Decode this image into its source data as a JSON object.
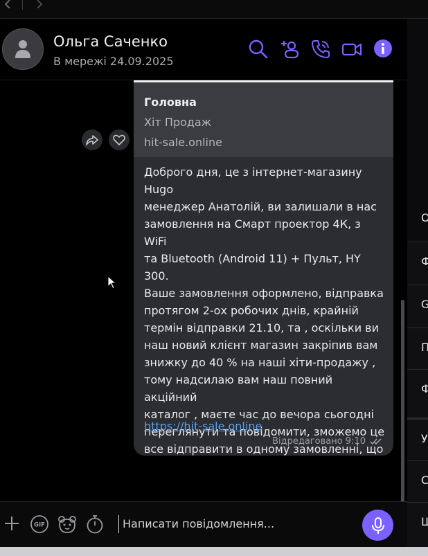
{
  "header": {
    "name": "Ольга Саченко",
    "status": "В мережі 24.09.2025"
  },
  "message": {
    "preview_title": "Головна",
    "preview_description": "Хіт Продаж",
    "preview_site": "hit-sale.online",
    "text": "Доброго дня, це з інтернет-магазину Hugo\nменеджер Анатолій, ви залишали в нас\nзамовлення на Смарт проектор 4К, з WiFi\nта Bluetooth (Android 11) + Пульт, HY 300.\nВаше замовлення оформлено, відправка\nпротягом 2-ох робочих днів, крайній\nтермін відправки 21.10, та , оскільки ви\nнаш новий клієнт магазин закріпив вам\nзнижку до 40 % на наші хіти-продажу ,\nтому надсилаю вам наш повний акційний\nкаталог , маєте час до вечора сьогодні\nпереглянути та повідомити, зможемо це\nвсе відправити в одному замовленні, що\nдійсно вигідно. + на весь товар є\nгарантія",
    "link": "https://hit-sale.online",
    "meta": "Відредаговано 9:10"
  },
  "composer": {
    "placeholder": "Написати повідомлення..."
  },
  "right_panel": {
    "letters": [
      "О",
      "Ф",
      "G",
      "П",
      "Ф",
      "У",
      "С",
      "Щ"
    ]
  },
  "colors": {
    "accent": "#7b61ff",
    "bubble": "#2b2d31",
    "link": "#5aa0ee",
    "check": "#1fbf55"
  }
}
